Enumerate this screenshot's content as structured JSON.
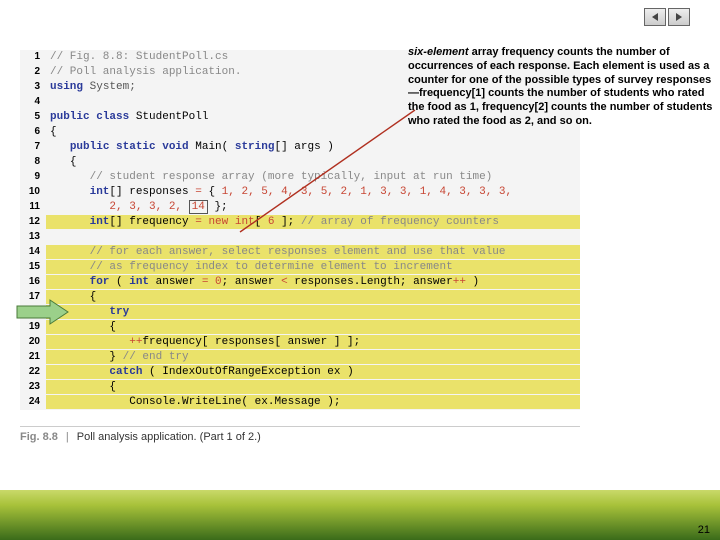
{
  "nav": {
    "prev": "◀",
    "next": "▶"
  },
  "annotation": {
    "line1_italic": "six-element",
    "line1_rest": " array frequency counts the number of occurrences of each response.",
    "line2": "Each element is used as a counter for one of the possible types of survey responses—frequency[1] counts the number of students who rated the food as 1,",
    "line3": "frequency[2] counts the number of students who rated the food as 2, and so on."
  },
  "code": {
    "l1": "// Fig. 8.8: StudentPoll.cs",
    "l2": "// Poll analysis application.",
    "l3a": "using",
    "l3b": " System;",
    "l5a": "public class",
    "l5b": " StudentPoll",
    "l7a": "public static void",
    "l7b": " Main( ",
    "l7c": "string",
    "l7d": "[] args )",
    "l9": "// student response array (more typically, input at run time)",
    "l10a": "int",
    "l10b": "[] responses ",
    "l10c": "=",
    "l10d": " { ",
    "l10e": "1, 2, 5, 4, 3, 5, 2, 1, 3, 3, 1, 4, 3, 3, 3,",
    "l11a": "2, 3, 3, 2, ",
    "l11num": "14",
    "l11b": " };",
    "l12a": "int",
    "l12b": "[] frequency ",
    "l12c": "= new int",
    "l12d": "[ ",
    "l12e": "6",
    "l12f": " ]; ",
    "l12g": "// array of frequency counters",
    "l14": "// for each answer, select responses element and use that value",
    "l15": "// as frequency index to determine element to increment",
    "l16a": "for",
    "l16b": " ( ",
    "l16c": "int",
    "l16d": " answer ",
    "l16e": "= 0",
    "l16f": "; answer ",
    "l16g": "<",
    "l16h": " responses.Length; answer",
    "l16i": "++",
    "l16j": " )",
    "l18a": "try",
    "l20a": "++",
    "l20b": "frequency[ responses[ answer ] ];",
    "l21a": "} ",
    "l21b": "// end try",
    "l22a": "catch",
    "l22b": " ( IndexOutOfRangeException ex )",
    "l24": "Console.WriteLine( ex.Message );",
    "open": "{",
    "close": "}"
  },
  "caption": {
    "figno": "Fig. 8.8",
    "sep": "|",
    "text": "Poll analysis application. (Part 1 of 2.)"
  },
  "page_number": "21"
}
